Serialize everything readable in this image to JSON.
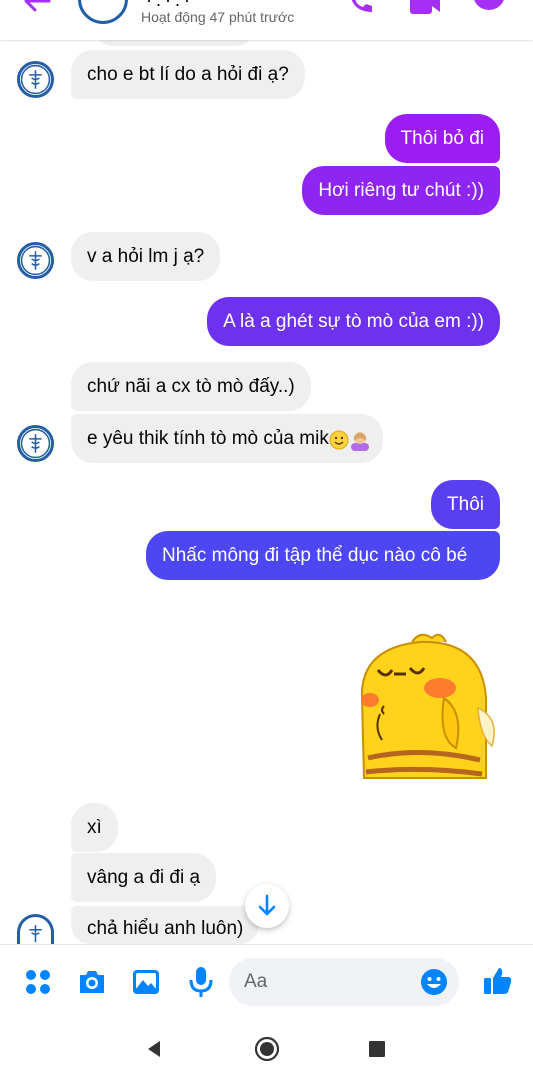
{
  "header": {
    "status": "Hoạt động 47 phút trước",
    "name_visible": "·.·.·",
    "icons": [
      "back-arrow-icon",
      "phone-icon",
      "video-camera-icon",
      "info-icon"
    ]
  },
  "messages": [
    {
      "text": "cho e bt lí do a hỏi đi ạ?"
    },
    {
      "text": "Thôi bỏ đi"
    },
    {
      "text": "Hơi riêng tư chút :))"
    },
    {
      "text": "v a hỏi lm j ạ?"
    },
    {
      "text": "A là a ghét sự tò mò của em :))"
    },
    {
      "text": "chứ nãi a cx tò mò đấy..)"
    },
    {
      "text": "e yêu thik tính tò mò của mik"
    },
    {
      "text": "Thôi"
    },
    {
      "text": "Nhấc mông đi tập thể dục nào cô bé"
    },
    {
      "text": "xì"
    },
    {
      "text": "vâng a đi đi ạ"
    },
    {
      "text": "chả hiểu anh luôn)"
    }
  ],
  "sticker": {
    "name": "yellow-chick-sticker"
  },
  "composer": {
    "placeholder": "Aa",
    "icons": [
      "apps-grid-icon",
      "camera-icon",
      "gallery-icon",
      "microphone-icon",
      "emoji-icon",
      "thumbs-up-icon"
    ]
  },
  "colors": {
    "accent": "#0084ff",
    "outgoing_top": "#9a1cf3",
    "outgoing_mid": "#7a2cf0",
    "outgoing_bottom": "#4f45f2",
    "incoming": "#efefef"
  },
  "navbar": {
    "icons": [
      "nav-back-icon",
      "nav-home-icon",
      "nav-recents-icon"
    ]
  }
}
